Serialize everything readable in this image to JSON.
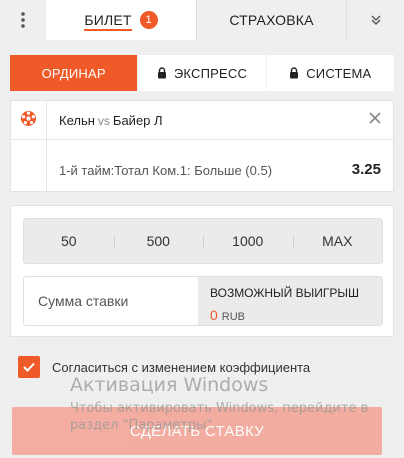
{
  "colors": {
    "accent": "#f05a28",
    "disabled_button": "#f4a89a"
  },
  "tabs": {
    "menu_icon": "kebab-menu-icon",
    "ticket_label": "БИЛЕТ",
    "ticket_count": "1",
    "insurance_label": "СТРАХОВКА",
    "collapse_icon": "double-chevron-down-icon"
  },
  "bet_types": {
    "single": "ОРДИНАР",
    "express": "ЭКСПРЕСС",
    "system": "СИСТЕМА",
    "lock_icon": "lock-icon"
  },
  "bet": {
    "sport_icon": "soccer-ball-icon",
    "home": "Кельн",
    "vs": "vs",
    "away": "Байер Л",
    "market": "1-й тайм:Тотал Ком.1: Больше (0.5)",
    "odds": "3.25"
  },
  "stake": {
    "quick_amounts": [
      "50",
      "500",
      "1000",
      "MAX"
    ],
    "placeholder": "Сумма ставки",
    "possible_win_label": "ВОЗМОЖНЫЙ ВЫИГРЫШ",
    "possible_win_value": "0",
    "currency": "RUB"
  },
  "accept_changes": {
    "label": "Согласиться с изменением коэффициента",
    "checked": true
  },
  "watermark": {
    "title": "Активация Windows",
    "text": "Чтобы активировать Windows, перейдите в раздел \"Параметры\"."
  },
  "submit": {
    "label": "СДЕЛАТЬ СТАВКУ"
  }
}
